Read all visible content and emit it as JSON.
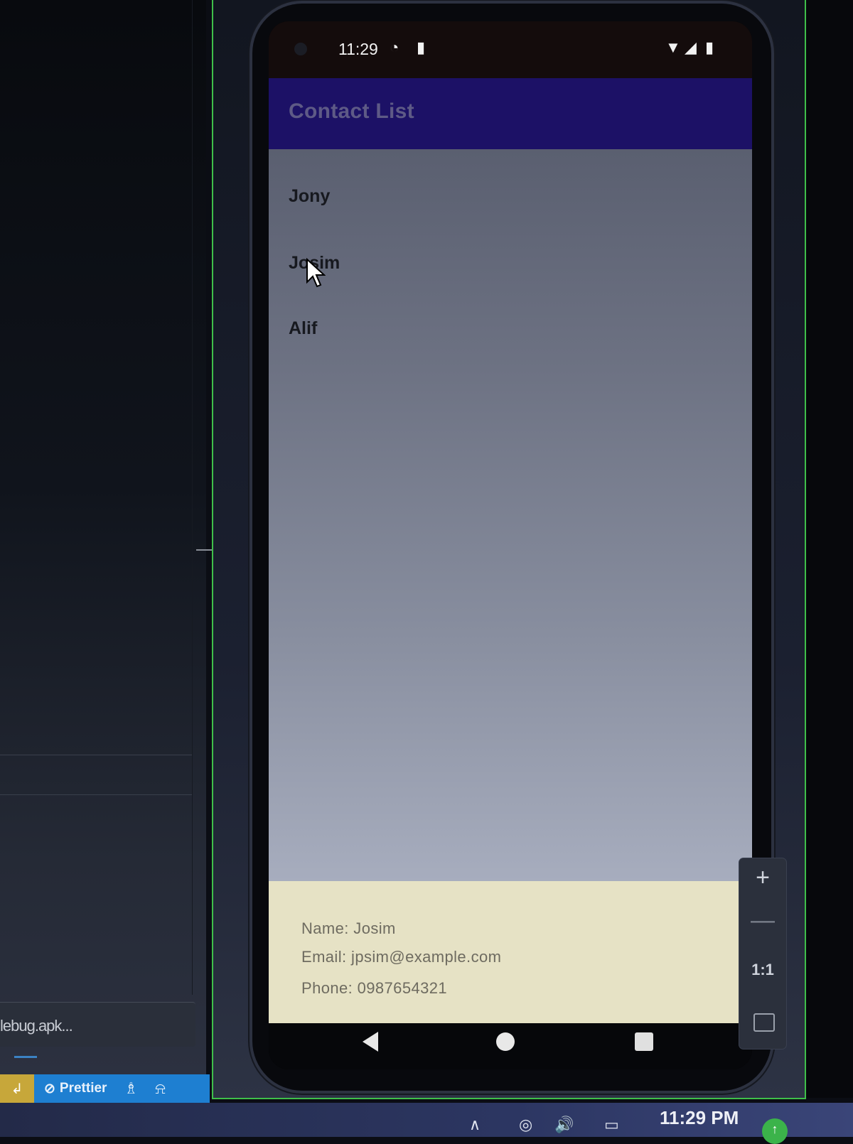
{
  "ide": {
    "apk_label": "lebug.apk...",
    "status_bar": {
      "prettier_label": "Prettier"
    }
  },
  "emulator": {
    "status_time": "11:29",
    "app_title": "Contact List",
    "contacts": [
      "Jony",
      "Josim",
      "Alif"
    ],
    "details": {
      "name": "Name: Josim",
      "email": "Email: jpsim@example.com",
      "phone": "Phone: 0987654321"
    },
    "zoom_controls": {
      "zoom_in": "+",
      "zoom_out": "—",
      "actual_size": "1:1"
    }
  },
  "taskbar": {
    "clock": "11:29 PM"
  },
  "colors": {
    "app_bar": "#1c1166",
    "details_bg": "#e6e2c5",
    "ide_status": "#1e7fd1",
    "emulator_border": "#3fbf4a"
  }
}
